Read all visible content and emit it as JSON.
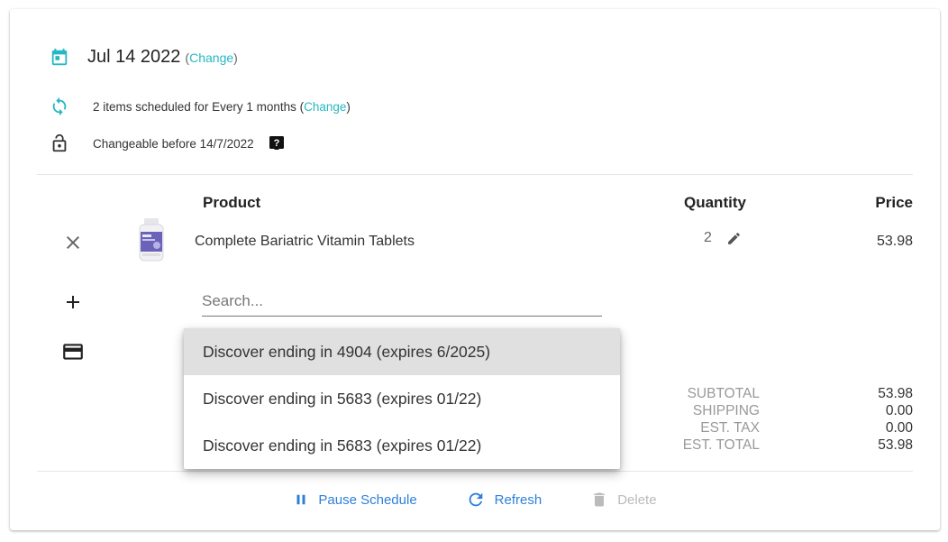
{
  "schedule": {
    "date": "Jul 14 2022",
    "date_change_link": "Change",
    "frequency_text": "2 items scheduled for Every 1 months",
    "frequency_change_link": "Change",
    "changeable_text": "Changeable before 14/7/2022"
  },
  "table": {
    "headers": {
      "product": "Product",
      "quantity": "Quantity",
      "price": "Price"
    },
    "rows": [
      {
        "name": "Complete Bariatric Vitamin Tablets",
        "quantity": "2",
        "price": "53.98"
      }
    ]
  },
  "search": {
    "placeholder": "Search..."
  },
  "payment_dropdown": {
    "options": [
      "Discover ending in 4904 (expires 6/2025)",
      "Discover ending in 5683 (expires 01/22)",
      "Discover ending in 5683 (expires 01/22)"
    ],
    "selected_index": 0
  },
  "totals": {
    "subtotal_label": "SUBTOTAL",
    "subtotal": "53.98",
    "shipping_label": "SHIPPING",
    "shipping": "0.00",
    "tax_label": "EST. TAX",
    "tax": "0.00",
    "total_label": "EST. TOTAL",
    "total": "53.98"
  },
  "actions": {
    "pause": "Pause Schedule",
    "refresh": "Refresh",
    "delete": "Delete"
  },
  "colors": {
    "accent_teal": "#25b8c4",
    "action_blue": "#2f7fd8",
    "disabled_gray": "#bbbbbb"
  },
  "icons": {
    "date": "calendar-icon",
    "frequency": "sync-icon",
    "lock": "unlock-icon",
    "help": "help-icon",
    "remove": "close-icon",
    "edit": "pencil-icon",
    "add": "plus-icon",
    "payment": "credit-card-icon",
    "pause": "pause-icon",
    "refresh": "refresh-icon",
    "delete": "trash-icon"
  }
}
